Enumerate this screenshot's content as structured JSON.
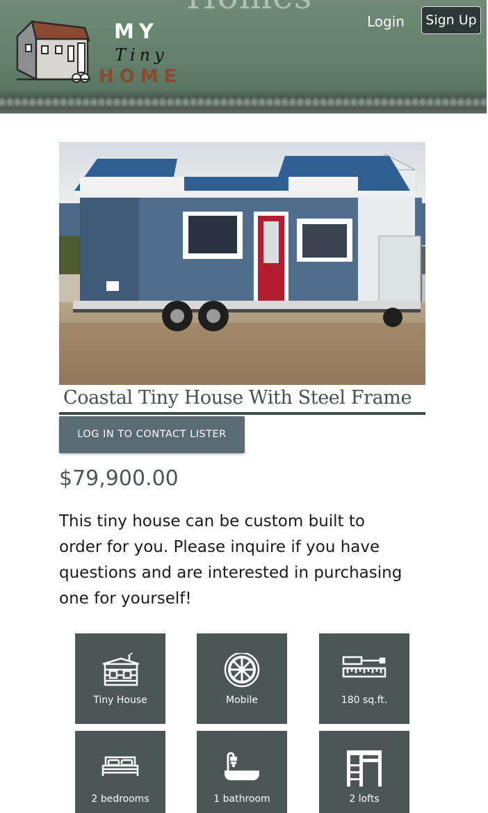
{
  "header": {
    "background_title": "Homes",
    "logo": {
      "line1": "MY",
      "line2": "Tiny",
      "line3": "HOME"
    },
    "nav": {
      "login_label": "Login",
      "signup_label": "Sign Up"
    }
  },
  "listing": {
    "title": "Coastal Tiny House With Steel Frame",
    "contact_button_label": "LOG IN TO CONTACT LISTER",
    "price": "$79,900.00",
    "description": "This tiny house can be custom built to order for you. Please inquire if you have questions and are interested in purchasing one for yourself!"
  },
  "features": [
    {
      "icon": "tiny-house-icon",
      "label": "Tiny House"
    },
    {
      "icon": "wheel-icon",
      "label": "Mobile"
    },
    {
      "icon": "measuring-tape-icon",
      "label": "180 sq.ft."
    },
    {
      "icon": "bed-icon",
      "label": "2 bedrooms"
    },
    {
      "icon": "bathtub-icon",
      "label": "1 bathroom"
    },
    {
      "icon": "loft-ladder-icon",
      "label": "2 lofts"
    }
  ],
  "colors": {
    "header_green": "#62806a",
    "tile_bg": "#4c5656",
    "button_bg": "#5a6a72",
    "title_color": "#41524d",
    "logo_home": "#8a4a32"
  }
}
